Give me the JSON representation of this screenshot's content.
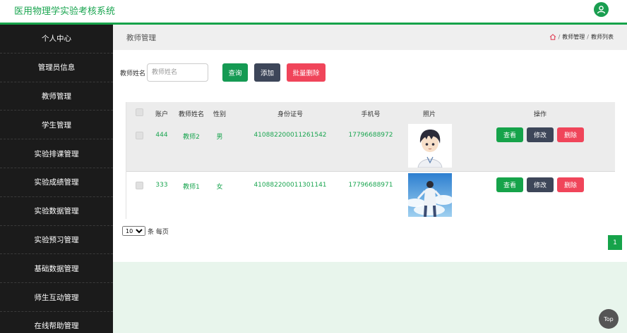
{
  "app": {
    "title": "医用物理学实验考核系统",
    "user_icon": "user-icon"
  },
  "sidebar": {
    "items": [
      {
        "label": "个人中心"
      },
      {
        "label": "管理员信息"
      },
      {
        "label": "教师管理"
      },
      {
        "label": "学生管理"
      },
      {
        "label": "实验排课管理"
      },
      {
        "label": "实验成绩管理"
      },
      {
        "label": "实验数据管理"
      },
      {
        "label": "实验预习管理"
      },
      {
        "label": "基础数据管理"
      },
      {
        "label": "师生互动管理"
      },
      {
        "label": "在线帮助管理"
      }
    ]
  },
  "page": {
    "title": "教师管理",
    "breadcrumb": {
      "home_icon": "home-icon",
      "sep": "/",
      "level1": "教师管理",
      "level2": "教师列表"
    }
  },
  "search": {
    "label": "教师姓名",
    "placeholder": "教师姓名",
    "query_label": "查询",
    "add_label": "添加",
    "batch_delete_label": "批量删除"
  },
  "table": {
    "headers": [
      "账户",
      "教师姓名",
      "性别",
      "身份证号",
      "手机号",
      "照片",
      "操作"
    ],
    "rows": [
      {
        "account": "444",
        "name": "教师2",
        "gender": "男",
        "id_card": "410882200011261542",
        "phone": "17796688972",
        "photo": "cartoon-boy-avatar"
      },
      {
        "account": "333",
        "name": "教师1",
        "gender": "女",
        "id_card": "410882200011301141",
        "phone": "17796688971",
        "photo": "boy-sky-photo"
      }
    ],
    "actions": {
      "view": "查看",
      "edit": "修改",
      "delete": "删除"
    }
  },
  "pager": {
    "page_size": "10",
    "per_page_label": "条 每页",
    "current_page": "1"
  },
  "back_to_top": "Top",
  "colors": {
    "accent": "#16a34a",
    "sidebar_bg": "#1b1b1b",
    "danger": "#f0455a",
    "dark_button": "#3d4659"
  }
}
